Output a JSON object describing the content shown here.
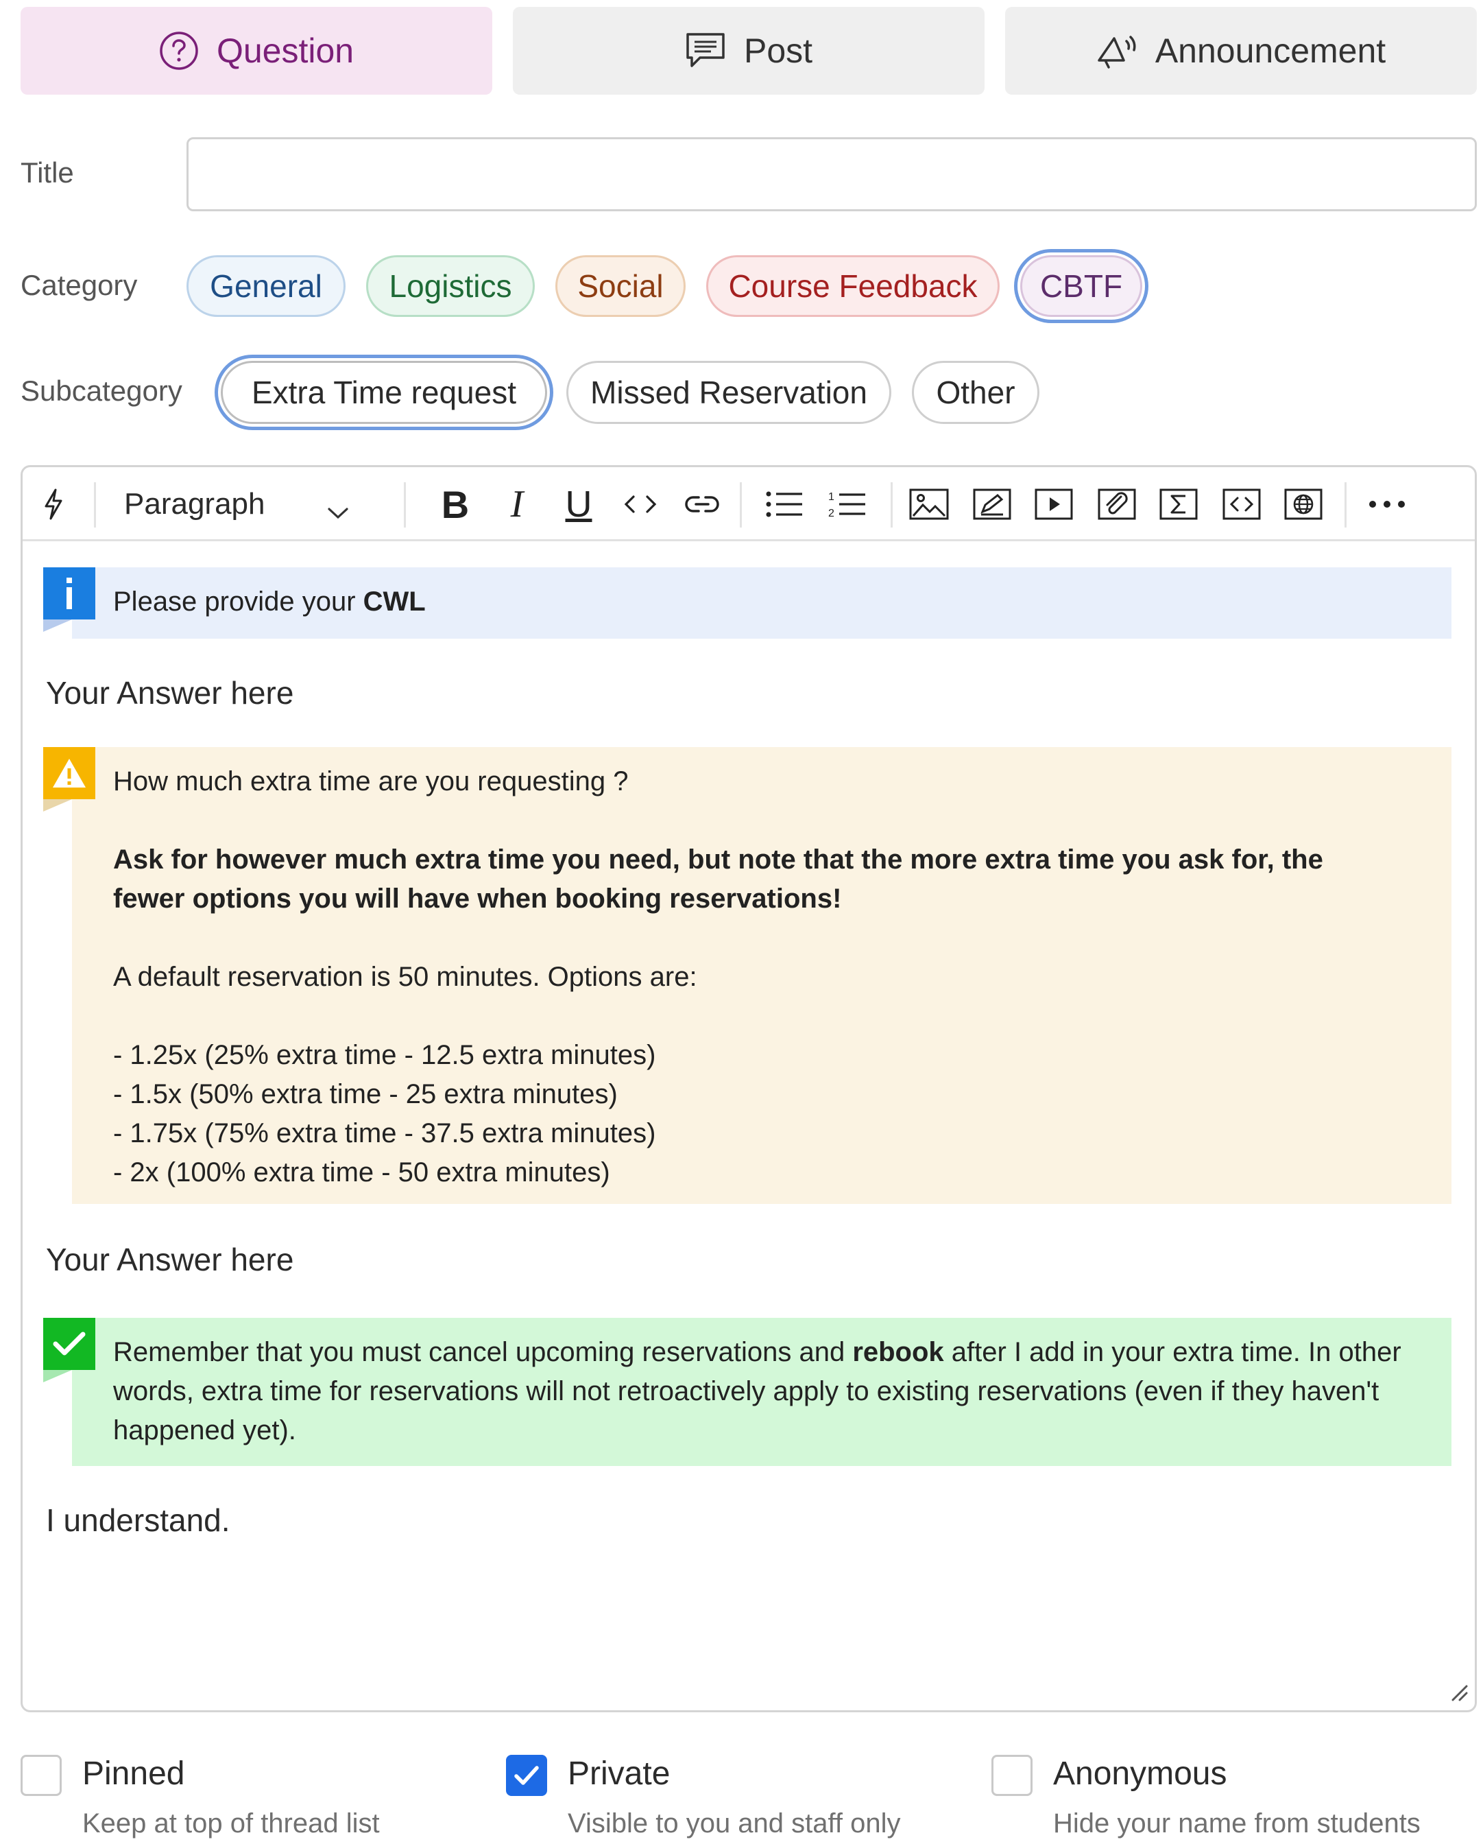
{
  "post_types": [
    {
      "label": "Question",
      "icon": "question-circle-icon",
      "active": true
    },
    {
      "label": "Post",
      "icon": "comment-icon",
      "active": false
    },
    {
      "label": "Announcement",
      "icon": "megaphone-icon",
      "active": false
    }
  ],
  "form": {
    "title_label": "Title",
    "title_value": "",
    "category_label": "Category",
    "subcategory_label": "Subcategory"
  },
  "categories": [
    {
      "label": "General",
      "bg": "#eef5fb",
      "border": "#bcd3ea",
      "color": "#1e4e86",
      "selected": false
    },
    {
      "label": "Logistics",
      "bg": "#eaf7ef",
      "border": "#b7dfc6",
      "color": "#1e6a36",
      "selected": false
    },
    {
      "label": "Social",
      "bg": "#fbf0e6",
      "border": "#ecceb1",
      "color": "#8d3d12",
      "selected": false
    },
    {
      "label": "Course Feedback",
      "bg": "#fcecec",
      "border": "#efbcbc",
      "color": "#a42020",
      "selected": false
    },
    {
      "label": "CBTF",
      "bg": "#f6eef7",
      "border": "#d9c3dc",
      "color": "#5c2d6b",
      "selected": true
    }
  ],
  "subcategories": [
    {
      "label": "Extra Time request",
      "selected": true
    },
    {
      "label": "Missed Reservation",
      "selected": false
    },
    {
      "label": "Other",
      "selected": false
    }
  ],
  "toolbar": {
    "paragraph_label": "Paragraph",
    "icons": [
      "lightning-icon",
      "bold-icon",
      "italic-icon",
      "underline-icon",
      "code-icon",
      "link-icon",
      "bullet-list-icon",
      "numbered-list-icon",
      "image-icon",
      "draw-icon",
      "video-icon",
      "attachment-icon",
      "math-icon",
      "embed-code-icon",
      "web-embed-icon",
      "more-icon"
    ]
  },
  "editor": {
    "info_callout": {
      "prefix": "Please provide your ",
      "bold": "CWL",
      "bg": "#e8effb",
      "badge": "#1a7ee0"
    },
    "answer_1": "Your Answer here",
    "warning_callout": {
      "line1": "How much extra time are you requesting ?",
      "bold_note": "Ask for however much extra time you need, but note that the more extra time you ask for, the fewer options you will have when booking reservations!",
      "default_note": "A default reservation is 50 minutes. Options are:",
      "options": [
        "- 1.25x (25% extra time - 12.5 extra minutes)",
        "- 1.5x (50% extra time - 25 extra minutes)",
        "- 1.75x (75% extra time - 37.5 extra minutes)",
        "- 2x (100% extra time - 50 extra minutes)"
      ],
      "bg": "#fbf3e2",
      "badge": "#f7b500"
    },
    "answer_2": "Your Answer here",
    "success_callout": {
      "prefix": "Remember that you must cancel upcoming reservations and ",
      "bold": "rebook",
      "suffix": " after I add in your extra time. In other words, extra time for reservations will not retroactively apply to existing reservations (even if they haven't happened yet).",
      "bg": "#d3f8d8",
      "badge": "#12b823"
    },
    "answer_3": "I understand."
  },
  "options": [
    {
      "label": "Pinned",
      "description": "Keep at top of thread list",
      "checked": false
    },
    {
      "label": "Private",
      "description": "Visible to you and staff only",
      "checked": true
    },
    {
      "label": "Anonymous",
      "description": "Hide your name from students",
      "checked": false
    }
  ]
}
